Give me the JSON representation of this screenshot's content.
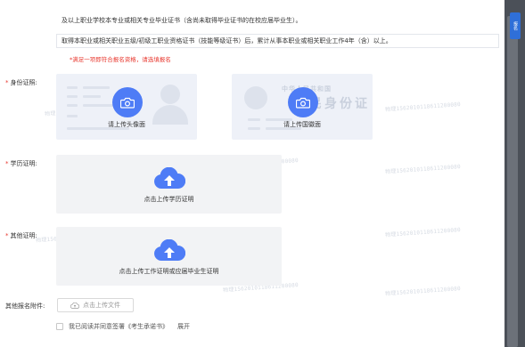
{
  "conditions": {
    "item_1": "及以上职业学校本专业或相关专业毕业证书（含尚未取得毕业证书的在校应届毕业生）。",
    "item_2": "取得本职业或相关职业五级/初级工职业资格证书（技能等级证书）后，累计从事本职业或相关职业工作4年（含）以上。"
  },
  "warning": "*满足一项即符合报名资格，请选填报名",
  "id_section": {
    "label": "身份证照:",
    "front": {
      "caption": "请上传头像面",
      "icon": "camera-icon"
    },
    "back": {
      "caption": "请上传国徽面",
      "card_title": "中华人民共和国",
      "card_big": "居民身份证",
      "icon": "camera-icon"
    }
  },
  "education": {
    "label": "学历证明:",
    "caption": "点击上传学历证明",
    "icon": "cloud-upload-icon"
  },
  "other_proof": {
    "label": "其他证明:",
    "caption": "点击上传工作证明或应届毕业生证明",
    "icon": "cloud-upload-icon"
  },
  "attachments": {
    "label": "其他报名附件:",
    "button_label": "点击上传文件",
    "icon": "cloud-upload-small-icon"
  },
  "agreement": {
    "text": "我已阅读并同意签署《考生承诺书》",
    "expand_label": "展开"
  },
  "watermark_text": "物理1562010118611200080",
  "side_tab_label": "报名",
  "colors": {
    "accent": "#4e7cf6",
    "warning": "#e8382f",
    "upload_bg": "#f2f3f5"
  }
}
